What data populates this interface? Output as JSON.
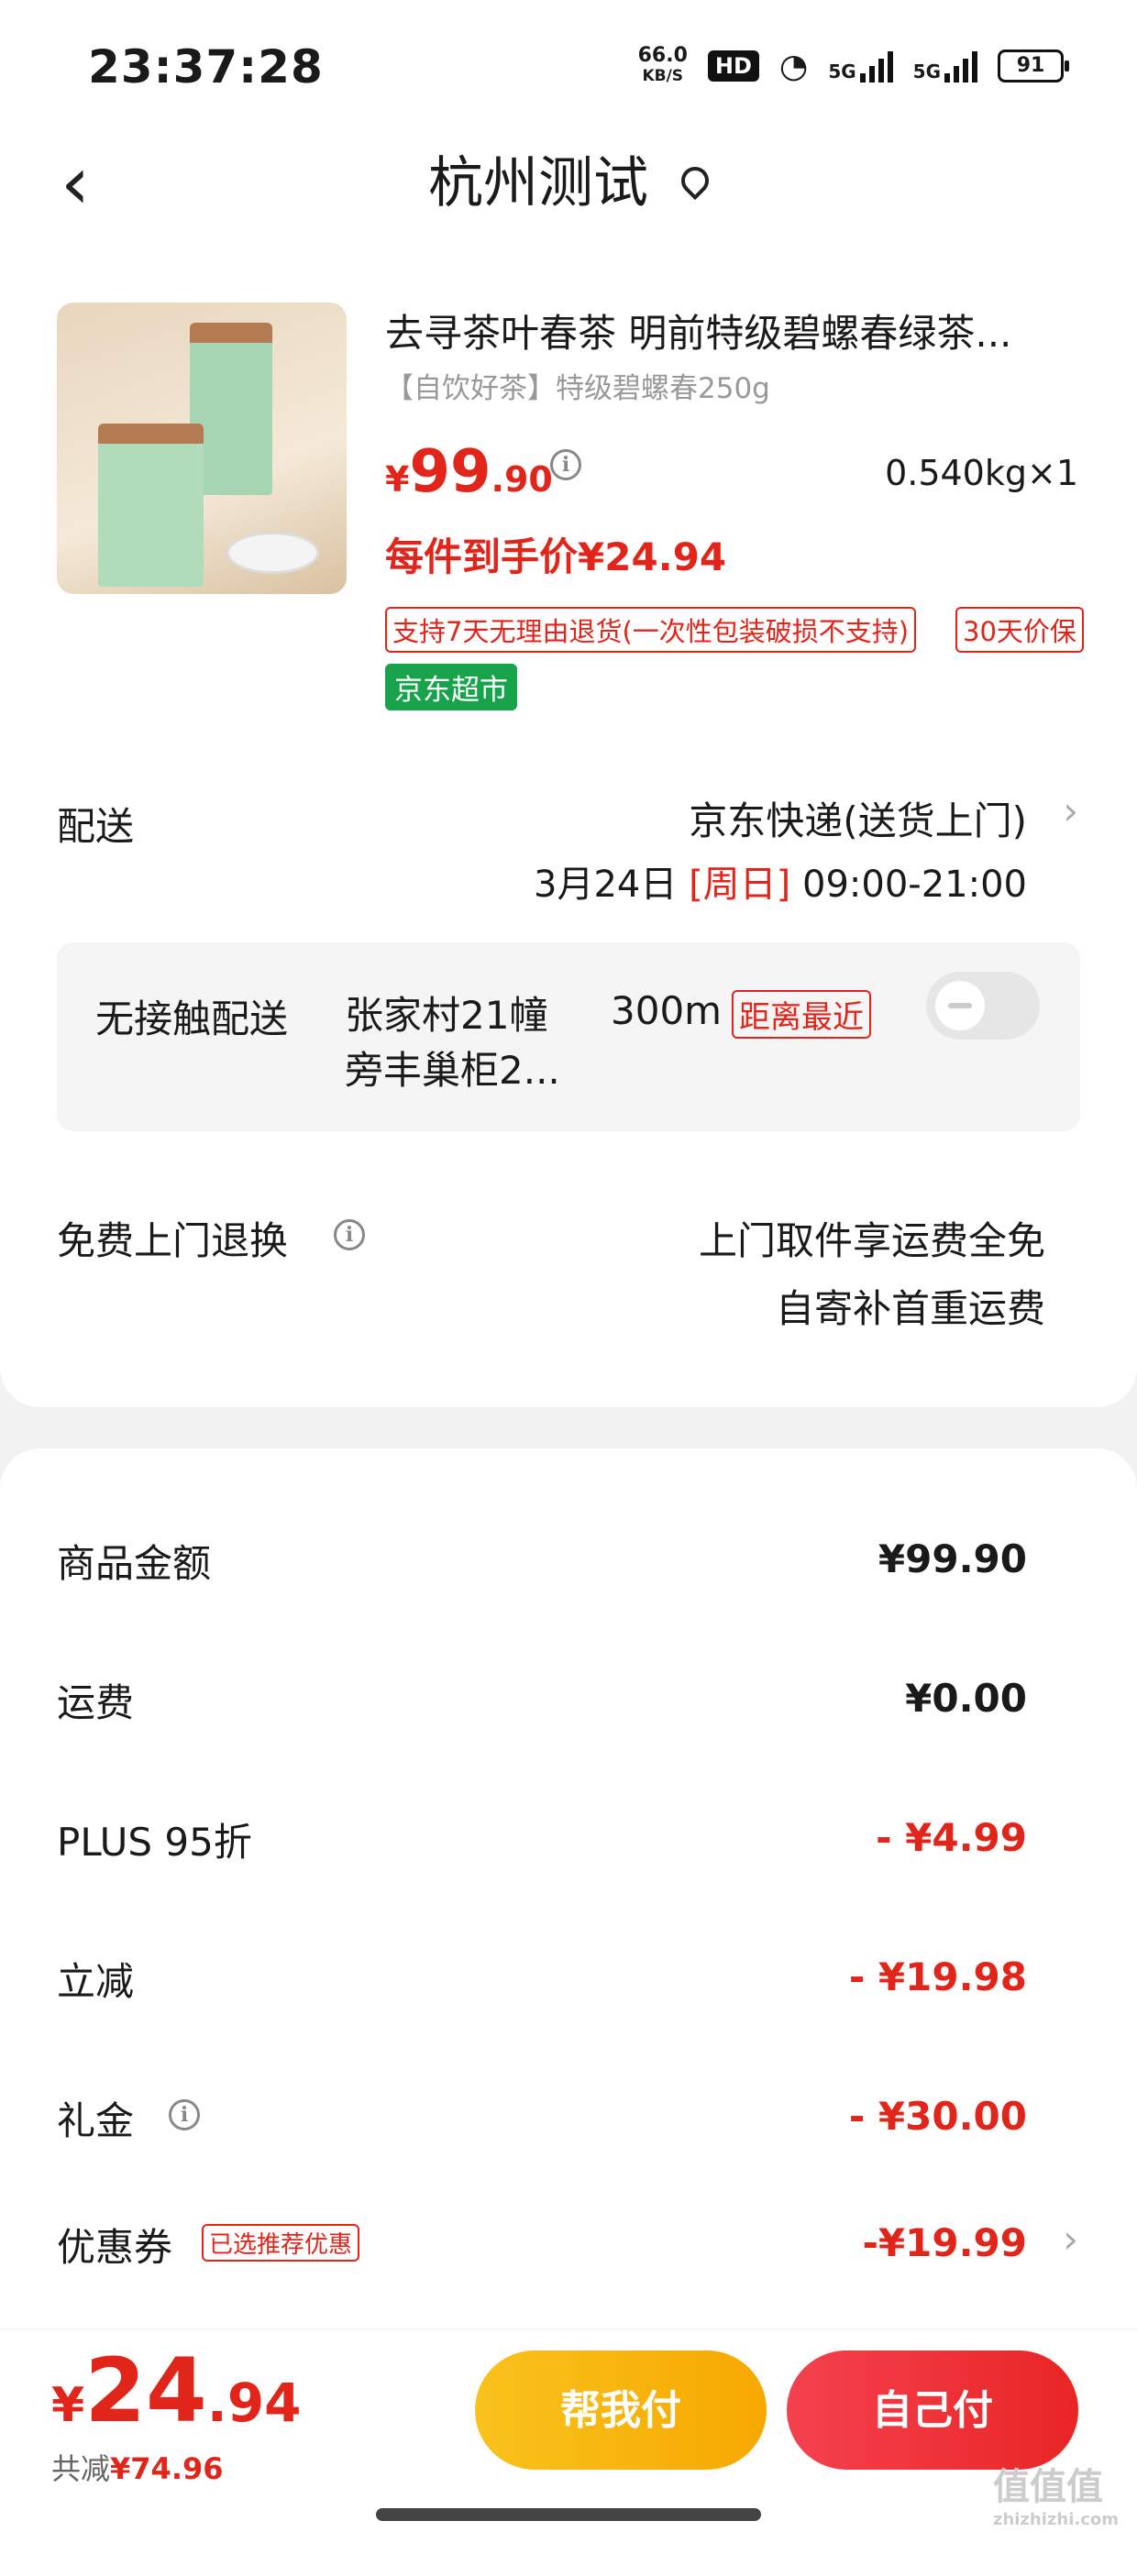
{
  "status_bar": {
    "time": "23:37:28",
    "net_speed_value": "66.0",
    "net_speed_unit": "KB/S",
    "hd_label": "HD",
    "sim1": "5G",
    "sim2": "5G",
    "battery": "91"
  },
  "header": {
    "title": "杭州测试",
    "back_icon": "chevron-left",
    "location_icon": "location-pin"
  },
  "product": {
    "name": "去寻茶叶春茶 明前特级碧螺春绿茶...",
    "subtitle": "【自饮好茶】特级碧螺春250g",
    "price_symbol": "¥",
    "price_int": "99",
    "price_dec": ".90",
    "weight_qty": "0.540kg×1",
    "per_item_price": "每件到手价¥24.94",
    "tag_return": "支持7天无理由退货(一次性包装破损不支持)",
    "tag_price_protect": "30天价保",
    "tag_store": "京东超市"
  },
  "delivery": {
    "label": "配送",
    "method": "京东快递(送货上门)",
    "date": "3月24日",
    "weekday": "[周日]",
    "window": "09:00-21:00"
  },
  "no_contact": {
    "label": "无接触配送",
    "address": "张家村21幢旁丰巢柜2...",
    "distance": "300m",
    "badge": "距离最近",
    "toggle_on": false
  },
  "returns": {
    "label": "免费上门退换",
    "line1": "上门取件享运费全免",
    "line2": "自寄补首重运费"
  },
  "summary": {
    "rows": [
      {
        "label": "商品金额",
        "value": "¥99.90"
      },
      {
        "label": "运费",
        "value": "¥0.00"
      },
      {
        "label": "PLUS 95折",
        "value": "- ¥4.99"
      },
      {
        "label": "立减",
        "value": "- ¥19.98"
      },
      {
        "label": "礼金",
        "value": "- ¥30.00"
      },
      {
        "label": "优惠券",
        "value": "-¥19.99"
      }
    ],
    "coupon_badge": "已选推荐优惠"
  },
  "footer": {
    "total_symbol": "¥",
    "total_int": "24",
    "total_dec": ".94",
    "saved_label": "共减",
    "saved_value": "¥74.96",
    "help_pay": "帮我付",
    "self_pay": "自己付"
  },
  "watermark": {
    "text": "值值值",
    "url": "zhizhizhi.com"
  },
  "colors": {
    "accent_red": "#e1251b",
    "yellow_button": "#f9c21d",
    "store_green": "#16a34a"
  }
}
